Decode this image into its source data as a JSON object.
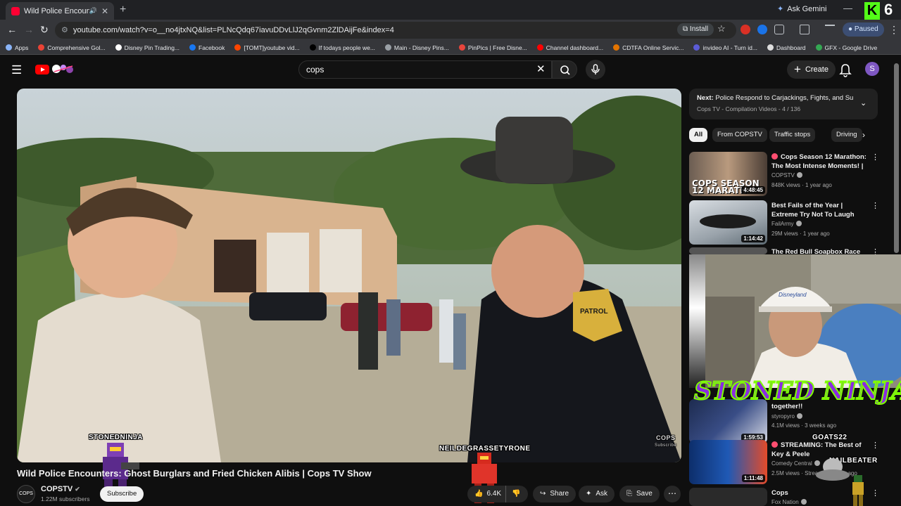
{
  "browser": {
    "tab_title": "Wild Police Encounters: Gh",
    "gemini_label": "Ask Gemini",
    "url": "youtube.com/watch?v=o__no4jtxNQ&list=PLNcQdq67iavuDDvLlJ2qGvnm2ZlDAijFe&index=4",
    "install_label": "Install",
    "paused_label": "Paused",
    "kick_badge": "K",
    "kick_count": "6",
    "bookmarks": [
      {
        "label": "Apps",
        "color": "#8ab4f8"
      },
      {
        "label": "Comprehensive Gol...",
        "color": "#ea4335"
      },
      {
        "label": "Disney Pin Trading...",
        "color": "#ffffff"
      },
      {
        "label": "Facebook",
        "color": "#1877f2"
      },
      {
        "label": "[TOMT]youtube vid...",
        "color": "#ff4500"
      },
      {
        "label": "If todays people we...",
        "color": "#000000"
      },
      {
        "label": "Main - Disney Pins...",
        "color": "#9aa0a6"
      },
      {
        "label": "PinPics | Free Disne...",
        "color": "#e8453c"
      },
      {
        "label": "Channel dashboard...",
        "color": "#ff0000"
      },
      {
        "label": "CDTFA Online Servic...",
        "color": "#e37400"
      },
      {
        "label": "invideo AI - Turn id...",
        "color": "#5b5bd6"
      },
      {
        "label": "Dashboard",
        "color": "#dddddd"
      },
      {
        "label": "GFX - Google Drive",
        "color": "#34a853"
      }
    ]
  },
  "youtube": {
    "search_value": "cops",
    "create_label": "Create",
    "avatar_letter": "S",
    "video": {
      "title": "Wild Police Encounters: Ghost Burglars and Fried Chicken Alibis | Cops TV Show",
      "channel": "COPSTV",
      "channel_avatar_text": "COPS",
      "subscribers": "1.22M subscribers",
      "subscribe_label": "Subscribe",
      "like_count": "6.4K",
      "share_label": "Share",
      "ask_label": "Ask",
      "save_label": "Save"
    },
    "up_next": {
      "prefix": "Next:",
      "title": "Police Respond to Carjackings, Fights, and Su...",
      "playlist": "Cops TV - Compilation Videos - 4 / 136"
    },
    "chips": [
      "All",
      "From COPSTV",
      "Traffic stops",
      "Driving"
    ],
    "recommendations": [
      {
        "title": "Cops Season 12 Marathon: The Most Intense Moments! | ...",
        "channel": "COPSTV",
        "meta": "848K views · 1 year ago",
        "duration": "4:48:45",
        "live_dot": true,
        "thumb_text": "COPS SEASON 12 MARATH"
      },
      {
        "title": "Best Fails of the Year | Extreme Try Not To Laugh Challenge",
        "channel": "FailArmy",
        "meta": "29M views · 1 year ago",
        "duration": "1:14:42",
        "live_dot": false
      },
      {
        "title": "The Red Bull Soapbox Race",
        "channel": "",
        "meta": "",
        "duration": "",
        "live_dot": false
      },
      {
        "title": "together!!",
        "channel": "styropyro",
        "meta": "4.1M views · 3 weeks ago",
        "duration": "1:59:53",
        "live_dot": false
      },
      {
        "title": "STREAMING: The Best of Key & Peele",
        "channel": "Comedy Central",
        "meta": "2.5M views · Streamed 1 year ago",
        "duration": "1:11:48",
        "live_dot": true
      },
      {
        "title": "Cops",
        "channel": "Fox Nation",
        "meta": "",
        "duration": "",
        "live_dot": false
      }
    ]
  },
  "overlays": {
    "stream_name": "STONED NINJA",
    "streamer_tag": "STONEDNINJA",
    "user_tag": "NEILDEGRASSETYRONE",
    "goats_tag": "GOATS22",
    "nail_tag": "NAILBEATER",
    "cam_hat_text": "Disneyland",
    "patch_text": "PATROL",
    "cops_watermark": "COPS",
    "subscribe_watermark": "Subscribe"
  }
}
